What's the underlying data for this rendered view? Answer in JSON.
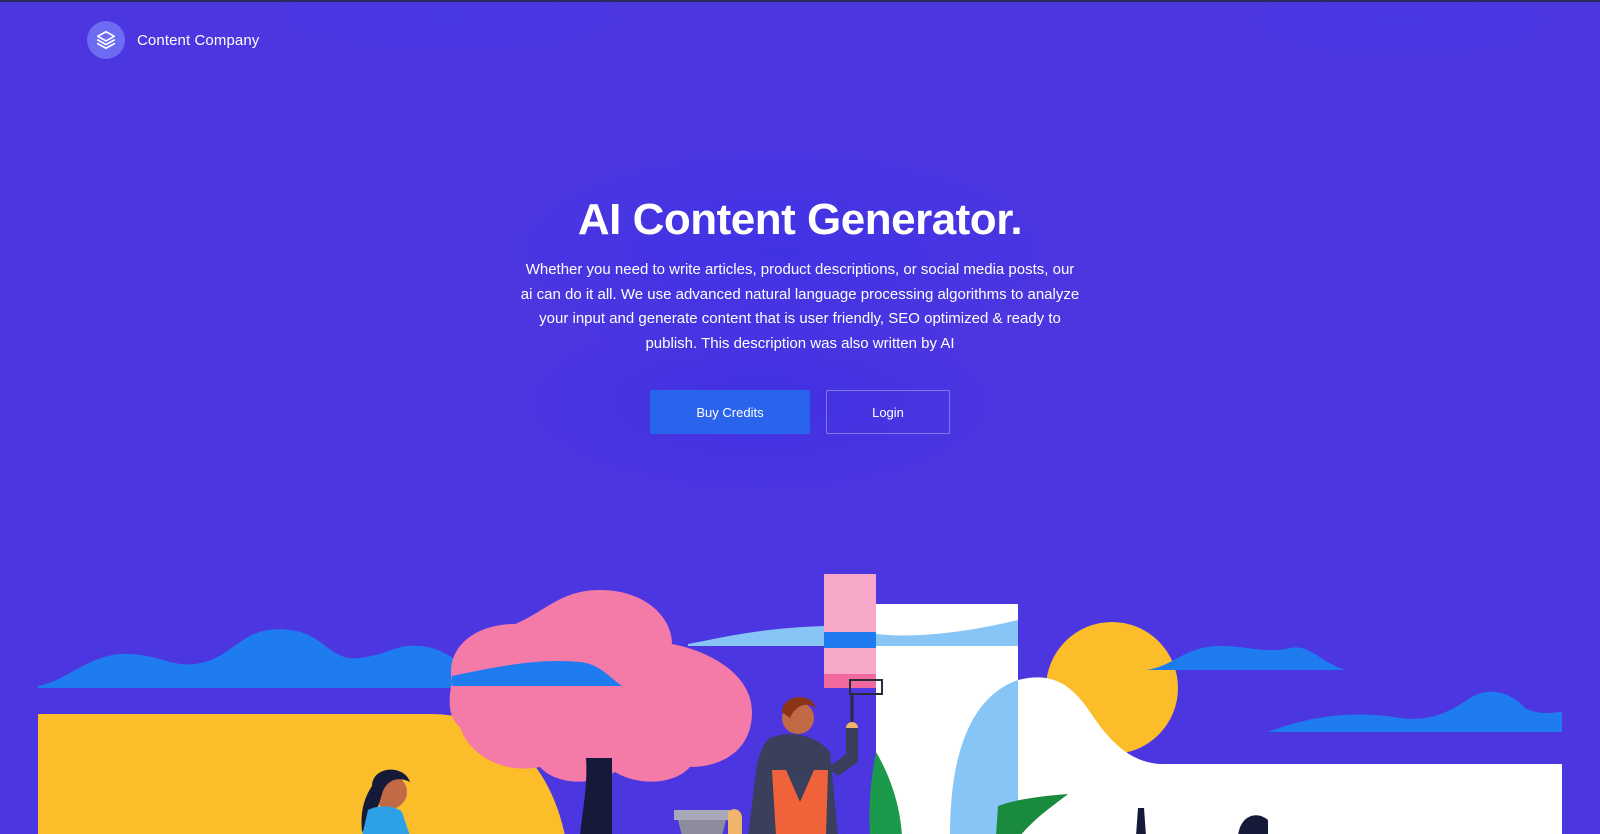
{
  "brand": {
    "name": "Content Company",
    "logo_icon": "layers-icon"
  },
  "hero": {
    "title": "AI Content Generator.",
    "description": "Whether you need to write articles, product descriptions, or social media posts, our ai can do it all. We use advanced natural language processing algorithms to analyze your input and generate content that is user friendly, SEO optimized & ready to publish. This description was also written by AI"
  },
  "actions": {
    "buy_credits_label": "Buy Credits",
    "login_label": "Login"
  },
  "colors": {
    "background": "#4c36e0",
    "primary_button": "#2a63ec",
    "logo_circle": "#6b6cf2"
  }
}
